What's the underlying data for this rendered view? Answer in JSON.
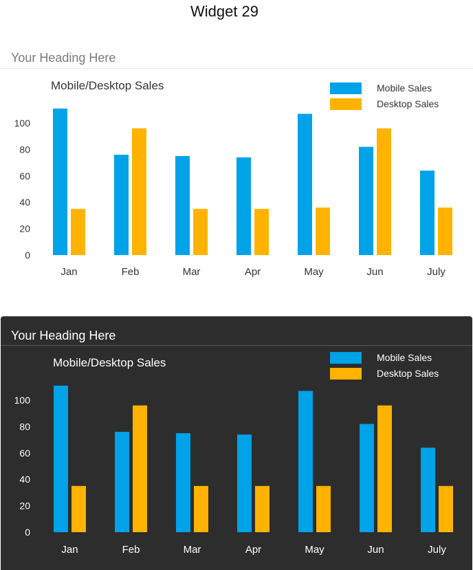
{
  "page_title": "Widget 29",
  "panels": [
    {
      "heading": "Your Heading Here",
      "theme": "light"
    },
    {
      "heading": "Your Heading Here",
      "theme": "dark"
    }
  ],
  "colors": {
    "mobile": "#00a2e8",
    "desktop": "#ffb300",
    "light_text": "#333333",
    "dark_text": "#ffffff"
  },
  "chart_data": [
    {
      "type": "bar",
      "title": "Mobile/Desktop Sales",
      "categories": [
        "Jan",
        "Feb",
        "Mar",
        "Apr",
        "May",
        "Jun",
        "July"
      ],
      "series": [
        {
          "name": "Mobile Sales",
          "values": [
            111,
            76,
            75,
            74,
            107,
            82,
            64
          ]
        },
        {
          "name": "Desktop Sales",
          "values": [
            35,
            96,
            35,
            35,
            36,
            96,
            36
          ]
        }
      ],
      "yticks": [
        0,
        20,
        40,
        60,
        80,
        100
      ],
      "ylim": [
        0,
        111
      ],
      "grid": false,
      "legend_position": "top-right"
    },
    {
      "type": "bar",
      "title": "Mobile/Desktop Sales",
      "categories": [
        "Jan",
        "Feb",
        "Mar",
        "Apr",
        "May",
        "Jun",
        "July"
      ],
      "series": [
        {
          "name": "Mobile Sales",
          "values": [
            111,
            76,
            75,
            74,
            107,
            82,
            64
          ]
        },
        {
          "name": "Desktop Sales",
          "values": [
            35,
            96,
            35,
            35,
            35,
            96,
            35
          ]
        }
      ],
      "yticks": [
        0,
        20,
        40,
        60,
        80,
        100
      ],
      "ylim": [
        0,
        111
      ],
      "grid": false,
      "legend_position": "top-right"
    }
  ]
}
